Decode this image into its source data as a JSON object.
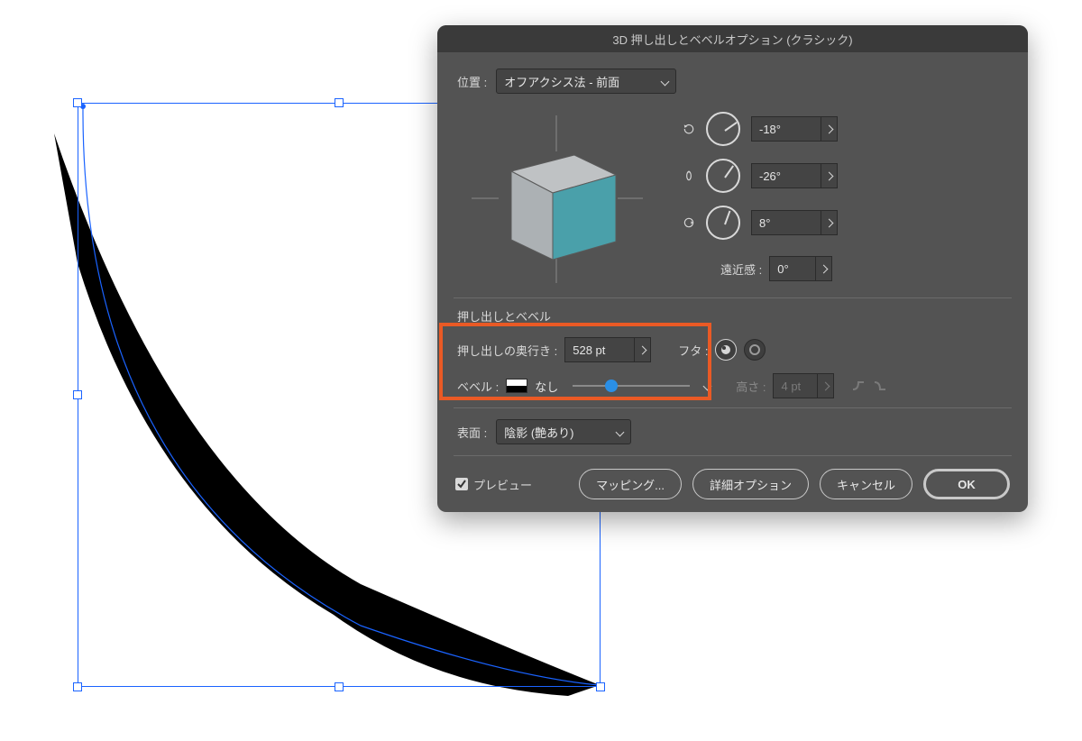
{
  "dialog": {
    "title": "3D 押し出しとベベルオプション (クラシック)",
    "position_label": "位置 :",
    "position_value": "オフアクシス法 - 前面",
    "rotX": "-18°",
    "rotY": "-26°",
    "rotZ": "8°",
    "perspective_label": "遠近感 :",
    "perspective_value": "0°",
    "section_extrude": "押し出しとベベル",
    "depth_label": "押し出しの奥行き :",
    "depth_value": "528 pt",
    "cap_label": "フタ :",
    "bevel_label": "ベベル :",
    "bevel_value": "なし",
    "height_label": "高さ :",
    "height_value": "4 pt",
    "surface_label": "表面 :",
    "surface_value": "陰影 (艶あり)",
    "preview": "プレビュー",
    "mapping": "マッピング...",
    "advanced": "詳細オプション",
    "cancel": "キャンセル",
    "ok": "OK"
  }
}
